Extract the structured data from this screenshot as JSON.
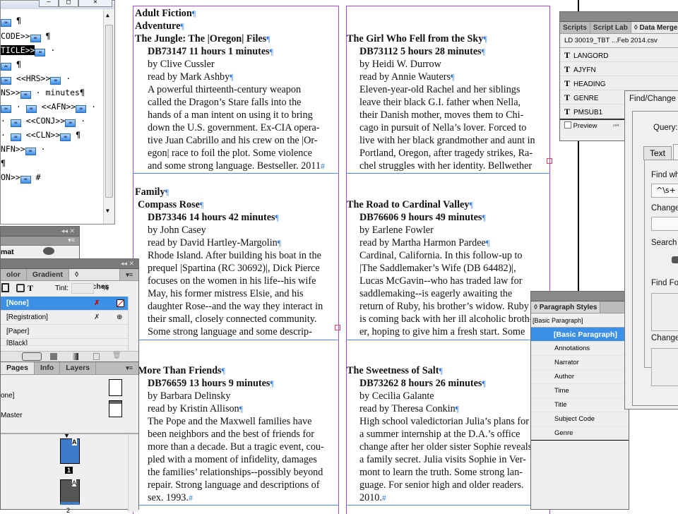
{
  "story_editor": {
    "title": "…",
    "lines": [
      {
        "pre": "",
        "text": "",
        "tail": "¶"
      },
      {
        "pre": "",
        "text": "CODE>>",
        "tail": "¶"
      },
      {
        "pre": "",
        "text": "TICLE>>",
        "tail": "·",
        "highlight": true
      },
      {
        "pre": "",
        "text": "",
        "tail": "¶"
      },
      {
        "pre": "",
        "text": "<<HRS>>",
        "tail": "·"
      },
      {
        "pre": "",
        "text": "NS>>",
        "tail": "· minutes¶"
      },
      {
        "pre": "",
        "text": "<<AFN>>",
        "tail": "·"
      },
      {
        "pre": "",
        "text": "<<CONJ>>",
        "tail": "·"
      },
      {
        "pre": "",
        "text": "<<CLN>>",
        "tail": "¶"
      },
      {
        "pre": "",
        "text": "NFN>>",
        "tail": "·"
      },
      {
        "pre": "",
        "text": "",
        "tail": "¶"
      },
      {
        "pre": "",
        "text": "ON>>",
        "tail": "#"
      }
    ]
  },
  "story_editor_buttons": {
    "minimize": "—",
    "restore": "□",
    "close": "✕"
  },
  "panels": {
    "format_panel": {
      "label": "mat"
    },
    "swatches": {
      "tabs": [
        "olor",
        "Gradient",
        "◊ Swatches"
      ],
      "tint_label": "Tint:",
      "tint_value": "",
      "tint_unit": "%",
      "items": [
        {
          "name": "[None]",
          "selected": true
        },
        {
          "name": "[Registration]",
          "selected": false
        },
        {
          "name": "[Paper]",
          "selected": false
        },
        {
          "name": "[Black]",
          "selected": false
        }
      ]
    },
    "pages": {
      "tabs": [
        "Pages",
        "Info",
        "Layers"
      ],
      "masters": [
        "one]",
        "Master"
      ],
      "page_numbers": [
        "1",
        "2"
      ],
      "page_label": "A"
    },
    "data_merge": {
      "tabs": [
        "Scripts",
        "Script Lab",
        "◊ Data Merge"
      ],
      "file": "LD 30019_TBT ...Feb 2014.csv",
      "fields": [
        "LANGORD",
        "AJYFN",
        "HEADING",
        "GENRE",
        "PMSUB1"
      ],
      "preview_label": "Preview"
    },
    "find_change": {
      "title": "Find/Change",
      "query_label": "Query:",
      "tab_text": "Text",
      "find_what_label": "Find wh",
      "find_what_value": "^\\s+",
      "change_to_label": "Change",
      "search_label": "Search",
      "find_format_label": "Find Fo",
      "change_format_label": "Change"
    },
    "paragraph_styles": {
      "title": "◊ Paragraph Styles",
      "current": "[Basic Paragraph]",
      "items": [
        "[Basic Paragraph]",
        "Annotations",
        "Narrator",
        "Author",
        "Time",
        "Title",
        "Subject Code",
        "Genre"
      ],
      "selected_index": 0
    }
  },
  "document": {
    "entries": [
      {
        "headings": [
          "Adult Fiction",
          "Adventure"
        ],
        "title": "The Jungle: The |Oregon| Files",
        "meta": "DB73147 11 hours 1 minutes",
        "author": "by Clive Cussler",
        "narrator": "read by Mark Ashby",
        "annotation": [
          "A powerful thirteenth-century weapon",
          "called the Dragon’s Stare falls into the",
          "hands of a man intent on using it to bring",
          "down the U.S. government. Ex-CIA opera-",
          "tive Juan Cabrillo and his crew on the |Or-",
          "egon| race to foil the plot. Some violence",
          "and some strong language. Bestseller. 2011"
        ]
      },
      {
        "headings": [],
        "title": "The Girl Who Fell from the Sky",
        "meta": "DB73112 5 hours 28 minutes",
        "author": "by Heidi W. Durrow",
        "narrator": "read by Annie Wauters",
        "annotation": [
          "Eleven-year-old Rachel and her siblings",
          "leave their black G.I. father when Nella,",
          "their Danish mother, moves them to Chi-",
          "cago in pursuit of Nella’s lover. Forced to",
          "live with her black grandmother and aunt in",
          "Portland, Oregon, after tragedy strikes, Ra-",
          "chel struggles with her identity. Bellwether"
        ]
      },
      {
        "headings": [
          "Family"
        ],
        "title": "Compass Rose",
        "meta": "DB73346 14 hours 42 minutes",
        "author": "by John Casey",
        "narrator": "read by David Hartley-Margolin",
        "annotation": [
          "Rhode Island. After building his boat in the",
          "prequel |Spartina (RC 30692)|, Dick Pierce",
          "focuses on the women in his life--his wife",
          "May, his former mistress Elsie, and his",
          "daughter Rose--and the way they interact in",
          "their small, closely connected community.",
          "Some strong language and some descrip-"
        ]
      },
      {
        "headings": [],
        "title": "The Road to Cardinal Valley",
        "meta": "DB76606 9 hours 49 minutes",
        "author": "by Earlene Fowler",
        "narrator": "read by Martha Harmon Pardee",
        "annotation": [
          "Cardinal, California. In this follow-up to",
          "|The Saddlemaker’s Wife (DB 64482)|,",
          "Lucas McGavin--who has traded law for",
          "saddlemaking--is eagerly awaiting the",
          "return of Ruby, his brother’s widow. Ruby",
          "is coming back with her ill alcoholic broth-",
          "er, hoping to give him a fresh start. Some"
        ]
      },
      {
        "headings": [],
        "title": "More Than Friends",
        "meta": "DB76659 13 hours 9 minutes",
        "author": "by Barbara Delinsky",
        "narrator": "read by Kristin Allison",
        "annotation": [
          "The Pope and the Maxwell families have",
          "been neighbors and the best of friends for",
          "more than a decade. But a tragic event, cou-",
          "pled with a moment of infidelity, damages",
          "the families’ relationships--possibly beyond",
          "repair. Strong language and descriptions of",
          "sex. 1993."
        ]
      },
      {
        "headings": [],
        "title": "The Sweetness of Salt",
        "meta": "DB73262 8 hours 26 minutes",
        "author": "by Cecilia Galante",
        "narrator": "read by Theresa Conkin",
        "annotation": [
          "High school valedictorian Julia’s plans for",
          "a summer internship at the D.A.’s office",
          "change after her older sister Sophie reveals",
          "a family secret. Julia visits Sophie in Ver-",
          "mont to learn the truth. Some strong lan-",
          "guage. For senior high and older readers.",
          "2010."
        ]
      }
    ]
  }
}
